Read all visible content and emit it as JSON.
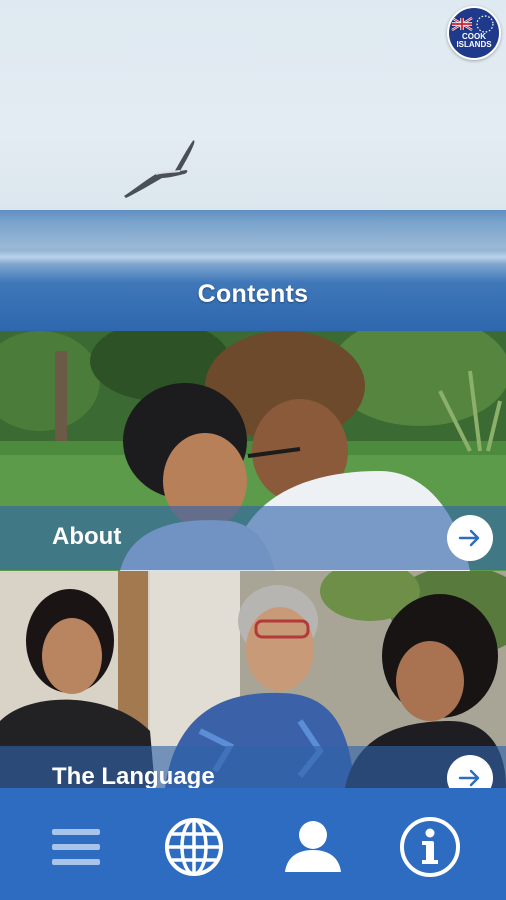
{
  "hero": {
    "title": "Contents",
    "badge_text_line1": "COOK",
    "badge_text_line2": "ISLANDS"
  },
  "cards": [
    {
      "label": "About",
      "arrow_icon": "arrow-right-icon"
    },
    {
      "label": "The Language",
      "arrow_icon": "arrow-right-icon"
    }
  ],
  "bottom_nav": {
    "items": [
      {
        "icon": "menu-icon"
      },
      {
        "icon": "globe-icon"
      },
      {
        "icon": "user-icon"
      },
      {
        "icon": "info-icon"
      }
    ]
  },
  "colors": {
    "nav_background": "#2d6cc0",
    "band_overlay": "#3163aa",
    "arrow_color": "#2d6cc0",
    "icon_light": "#a9c4ea"
  }
}
